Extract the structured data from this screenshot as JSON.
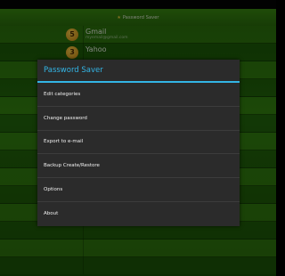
{
  "app": {
    "title": "Password Saver",
    "star": "★"
  },
  "background_list": [
    {
      "badge": "5",
      "title": "Gmail",
      "subtitle": "myemail@gmail.com"
    },
    {
      "badge": "3",
      "title": "Yahoo",
      "subtitle": ""
    }
  ],
  "dialog": {
    "title": "Password Saver",
    "items": [
      {
        "label": "Edit categories"
      },
      {
        "label": "Change password"
      },
      {
        "label": "Export to e-mail"
      },
      {
        "label": "Backup Create/Restore"
      },
      {
        "label": "Options"
      },
      {
        "label": "About"
      }
    ]
  },
  "colors": {
    "accent": "#33b5e5",
    "dialog_bg": "#2b2b2b",
    "background_green": "#2a7a0e"
  }
}
